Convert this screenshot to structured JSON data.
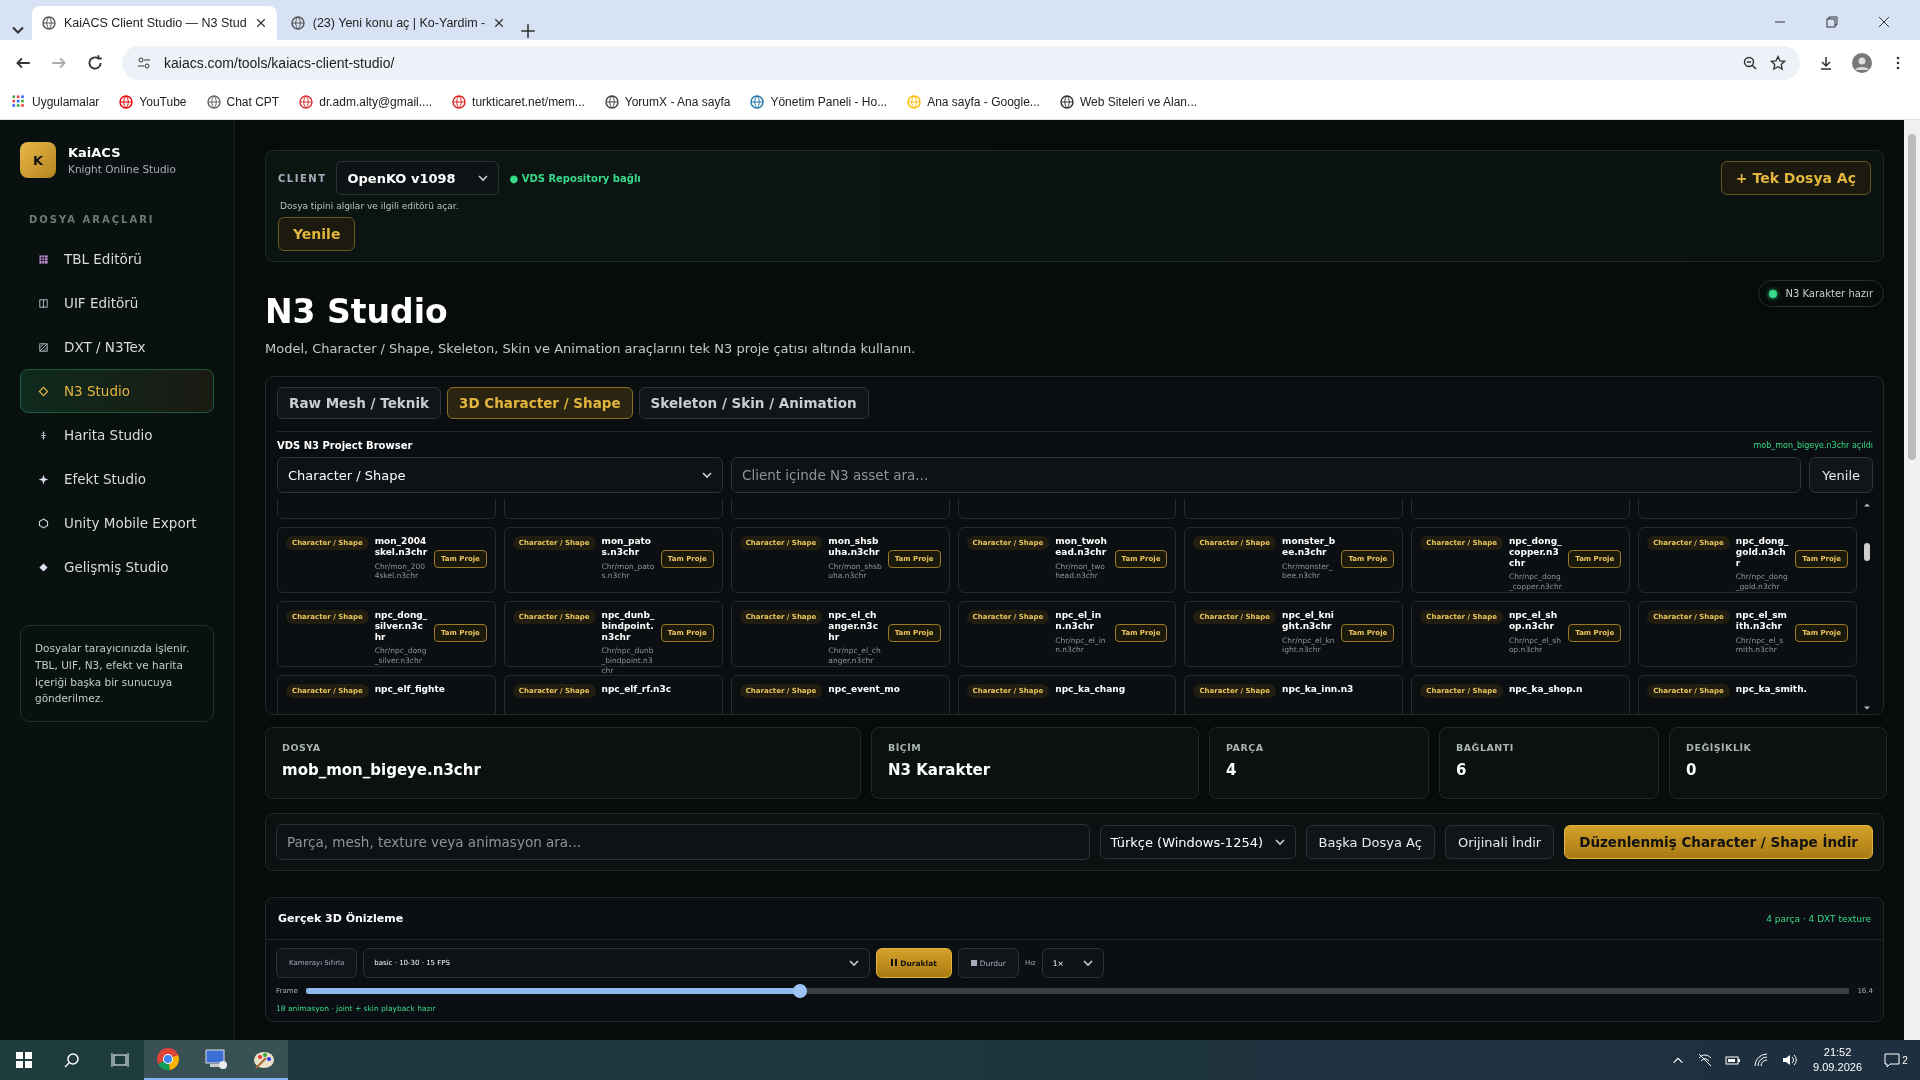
{
  "browser": {
    "tabs": [
      {
        "title": "KaiACS Client Studio — N3 Stud",
        "selected": true
      },
      {
        "title": "(23) Yeni konu aç | Ko-Yardim -",
        "selected": false
      }
    ],
    "url": "kaiacs.com/tools/kaiacs-client-studio/",
    "bookmarks": [
      "Uygulamalar",
      "YouTube",
      "Chat CPT",
      "dr.adm.alty@gmail....",
      "turkticaret.net/mem...",
      "YorumX - Ana sayfa",
      "Yönetim Paneli - Ho...",
      "Ana sayfa - Google...",
      "Web Siteleri ve Alan..."
    ]
  },
  "sidebar": {
    "logo_letter": "K",
    "name": "KaiACS",
    "subtitle": "Knight Online Studio",
    "section_title": "DOSYA ARAÇLARI",
    "items": [
      {
        "label": "TBL Editörü",
        "selected": false
      },
      {
        "label": "UIF Editörü",
        "selected": false
      },
      {
        "label": "DXT / N3Tex",
        "selected": false
      },
      {
        "label": "N3 Studio",
        "selected": true
      },
      {
        "label": "Harita Studio",
        "selected": false
      },
      {
        "label": "Efekt Studio",
        "selected": false
      },
      {
        "label": "Unity Mobile Export",
        "selected": false
      },
      {
        "label": "Gelişmiş Studio",
        "selected": false
      }
    ],
    "note": "Dosyalar tarayıcınızda işlenir. TBL, UIF, N3, efekt ve harita içeriği başka bir sunucuya gönderilmez."
  },
  "client_bar": {
    "label": "CLIENT",
    "client": "OpenKO v1098",
    "status": "● VDS Repository bağlı",
    "hint": "Dosya tipini algılar ve ilgili editörü açar.",
    "refresh": "Yenile",
    "open_button": "+  Tek Dosya Aç"
  },
  "header": {
    "title": "N3 Studio",
    "subtitle": "Model, Character / Shape, Skeleton, Skin ve Animation araçlarını tek N3 proje çatısı altında kullanın.",
    "badge": "N3 Karakter hazır"
  },
  "tabs": [
    {
      "label": "Raw Mesh / Teknik",
      "selected": false
    },
    {
      "label": "3D Character / Shape",
      "selected": true
    },
    {
      "label": "Skeleton / Skin / Animation",
      "selected": false
    }
  ],
  "project_browser": {
    "title": "VDS N3 Project Browser",
    "status": "mob_mon_bigeye.n3chr açıldı",
    "category": "Character / Shape",
    "search_placeholder": "Client içinde N3 asset ara...",
    "refresh": "Yenile",
    "cards": [
      {
        "tag": "Character / Shape",
        "name": "mon_2004skel.n3chr",
        "path": "Chr/mon_2004skel.n3chr",
        "action": "Tam Proje"
      },
      {
        "tag": "Character / Shape",
        "name": "mon_patos.n3chr",
        "path": "Chr/mon_patos.n3chr",
        "action": "Tam Proje"
      },
      {
        "tag": "Character / Shape",
        "name": "mon_shsbuha.n3chr",
        "path": "Chr/mon_shsbuha.n3chr",
        "action": "Tam Proje"
      },
      {
        "tag": "Character / Shape",
        "name": "mon_twohead.n3chr",
        "path": "Chr/mon_twohead.n3chr",
        "action": "Tam Proje"
      },
      {
        "tag": "Character / Shape",
        "name": "monster_bee.n3chr",
        "path": "Chr/monster_bee.n3chr",
        "action": "Tam Proje"
      },
      {
        "tag": "Character / Shape",
        "name": "npc_dong_copper.n3chr",
        "path": "Chr/npc_dong_copper.n3chr",
        "action": "Tam Proje"
      },
      {
        "tag": "Character / Shape",
        "name": "npc_dong_gold.n3chr",
        "path": "Chr/npc_dong_gold.n3chr",
        "action": "Tam Proje"
      },
      {
        "tag": "Character / Shape",
        "name": "npc_dong_silver.n3chr",
        "path": "Chr/npc_dong_silver.n3chr",
        "action": "Tam Proje"
      },
      {
        "tag": "Character / Shape",
        "name": "npc_dunb_bindpoint.n3chr",
        "path": "Chr/npc_dunb_bindpoint.n3chr",
        "action": "Tam Proje"
      },
      {
        "tag": "Character / Shape",
        "name": "npc_el_changer.n3chr",
        "path": "Chr/npc_el_changer.n3chr",
        "action": "Tam Proje"
      },
      {
        "tag": "Character / Shape",
        "name": "npc_el_inn.n3chr",
        "path": "Chr/npc_el_inn.n3chr",
        "action": "Tam Proje"
      },
      {
        "tag": "Character / Shape",
        "name": "npc_el_knight.n3chr",
        "path": "Chr/npc_el_knight.n3chr",
        "action": "Tam Proje"
      },
      {
        "tag": "Character / Shape",
        "name": "npc_el_shop.n3chr",
        "path": "Chr/npc_el_shop.n3chr",
        "action": "Tam Proje"
      },
      {
        "tag": "Character / Shape",
        "name": "npc_el_smith.n3chr",
        "path": "Chr/npc_el_smith.n3chr",
        "action": "Tam Proje"
      }
    ],
    "partial_cards": [
      {
        "tag": "Character / Shape",
        "name": "npc_elf_fighte"
      },
      {
        "tag": "Character / Shape",
        "name": "npc_elf_rf.n3c"
      },
      {
        "tag": "Character / Shape",
        "name": "npc_event_mo"
      },
      {
        "tag": "Character / Shape",
        "name": "npc_ka_chang"
      },
      {
        "tag": "Character / Shape",
        "name": "npc_ka_inn.n3"
      },
      {
        "tag": "Character / Shape",
        "name": "npc_ka_shop.n"
      },
      {
        "tag": "Character / Shape",
        "name": "npc_ka_smith."
      }
    ]
  },
  "stats": [
    {
      "label": "DOSYA",
      "value": "mob_mon_bigeye.n3chr"
    },
    {
      "label": "BİÇİM",
      "value": "N3 Karakter"
    },
    {
      "label": "PARÇA",
      "value": "4"
    },
    {
      "label": "BAĞLANTI",
      "value": "6"
    },
    {
      "label": "DEĞİŞİKLİK",
      "value": "0"
    }
  ],
  "toolbar": {
    "search_placeholder": "Parça, mesh, texture veya animasyon ara...",
    "encoding": "Türkçe (Windows-1254)",
    "buttons": [
      {
        "label": "Başka Dosya Aç",
        "kind": "plain"
      },
      {
        "label": "Orijinali İndir",
        "kind": "plain"
      },
      {
        "label": "Düzenlenmiş Character / Shape İndir",
        "kind": "primary"
      }
    ]
  },
  "preview": {
    "title": "Gerçek 3D Önizleme",
    "info": "4 parça · 4 DXT texture",
    "camera_reset": "Kamerayı Sıfırla",
    "animation": "basic · 10-30 · 15 FPS",
    "pause": "Duraklat",
    "stop": "Durdur",
    "speed_label": "Hız",
    "speed": "1×",
    "frame_label": "Frame",
    "frame": {
      "level": 0.32
    },
    "frame_end": "16.4",
    "footer": "18 animasyon · joint + skin playback hazır"
  },
  "taskbar": {
    "time": "21:52",
    "date": "9.09.2026",
    "notifications": "2"
  }
}
